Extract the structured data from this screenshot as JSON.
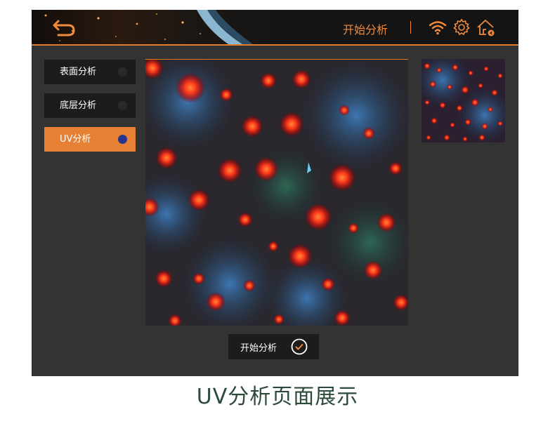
{
  "header": {
    "title": "开始分析",
    "icons": [
      "back-arrow-icon",
      "wifi-icon",
      "gear-icon",
      "home-icon"
    ],
    "accent_color": "#f08a3c"
  },
  "sidebar": {
    "items": [
      {
        "label": "表面分析",
        "active": false
      },
      {
        "label": "底层分析",
        "active": false
      },
      {
        "label": "UV分析",
        "active": true
      }
    ]
  },
  "actions": {
    "analyze_label": "开始分析"
  },
  "caption": "UV分析页面展示"
}
